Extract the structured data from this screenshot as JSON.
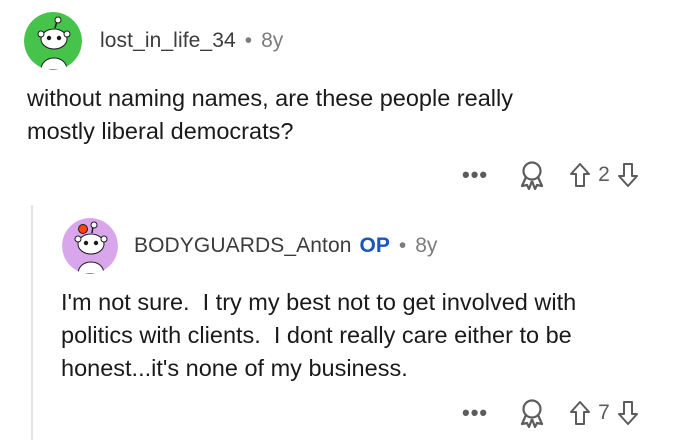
{
  "comments": [
    {
      "username": "lost_in_life_34",
      "is_op": false,
      "separator": "•",
      "age": "8y",
      "body": "without naming names, are these people really\nmostly liberal democrats?",
      "actions": {
        "more_label": "•••",
        "award_icon": "award-icon",
        "upvote_icon": "upvote-arrow-icon",
        "score": "2",
        "downvote_icon": "downvote-arrow-icon"
      },
      "avatar_color": "#46c34a"
    },
    {
      "username": "BODYGUARDS_Anton",
      "is_op": true,
      "op_label": "OP",
      "separator": "•",
      "age": "8y",
      "body": "I'm not sure.  I try my best not to get involved with\npolitics with clients.  I dont really care either to be\nhonest...it's none of my business.",
      "actions": {
        "more_label": "•••",
        "award_icon": "award-icon",
        "upvote_icon": "upvote-arrow-icon",
        "score": "7",
        "downvote_icon": "downvote-arrow-icon"
      },
      "avatar_color": "#d9a6ec"
    }
  ],
  "colors": {
    "op_badge": "#1a57b8",
    "meta_text": "#7c7c7c",
    "body_text": "#1a1a1b",
    "thread_line": "#e3e3e3"
  }
}
